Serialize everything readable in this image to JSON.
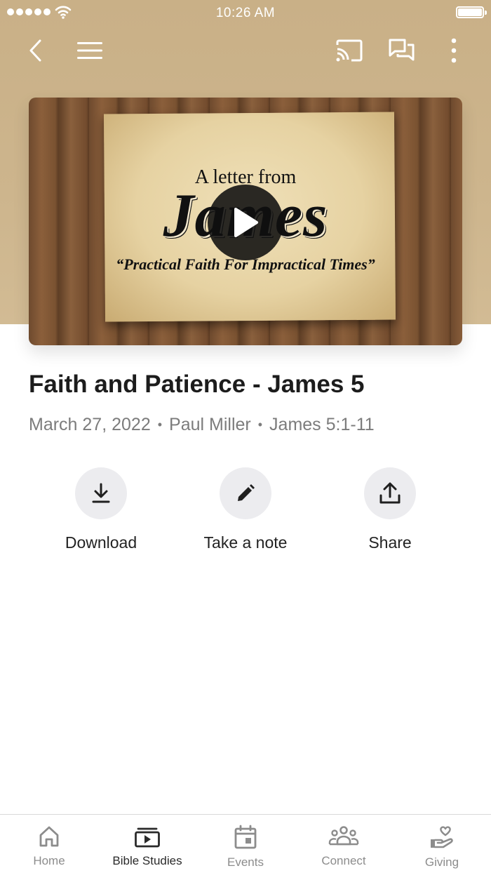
{
  "status_bar": {
    "time": "10:26 AM"
  },
  "nav": {
    "back_icon": "chevron-left-icon",
    "menu_icon": "hamburger-icon",
    "cast_icon": "cast-icon",
    "chat_icon": "chat-icon",
    "more_icon": "more-vertical-icon"
  },
  "video": {
    "line1": "A letter from",
    "title": "James",
    "tagline": "“Practical Faith For Impractical Times”"
  },
  "sermon": {
    "title": "Faith and Patience - James 5",
    "date": "March 27, 2022",
    "speaker": "Paul Miller",
    "passage": "James 5:1-11"
  },
  "actions": [
    {
      "label": "Download",
      "icon": "download-icon"
    },
    {
      "label": "Take a note",
      "icon": "pencil-icon"
    },
    {
      "label": "Share",
      "icon": "share-icon"
    }
  ],
  "tabs": [
    {
      "label": "Home",
      "icon": "home-icon"
    },
    {
      "label": "Bible Studies",
      "icon": "video-library-icon",
      "active": true
    },
    {
      "label": "Events",
      "icon": "calendar-icon"
    },
    {
      "label": "Connect",
      "icon": "group-icon"
    },
    {
      "label": "Giving",
      "icon": "giving-hand-icon"
    }
  ],
  "colors": {
    "header_bg": "#c9b087",
    "text_primary": "#1c1c1c",
    "text_secondary": "#7c7c7c",
    "tab_inactive": "#8c8c8c",
    "action_bg": "#ececef"
  }
}
